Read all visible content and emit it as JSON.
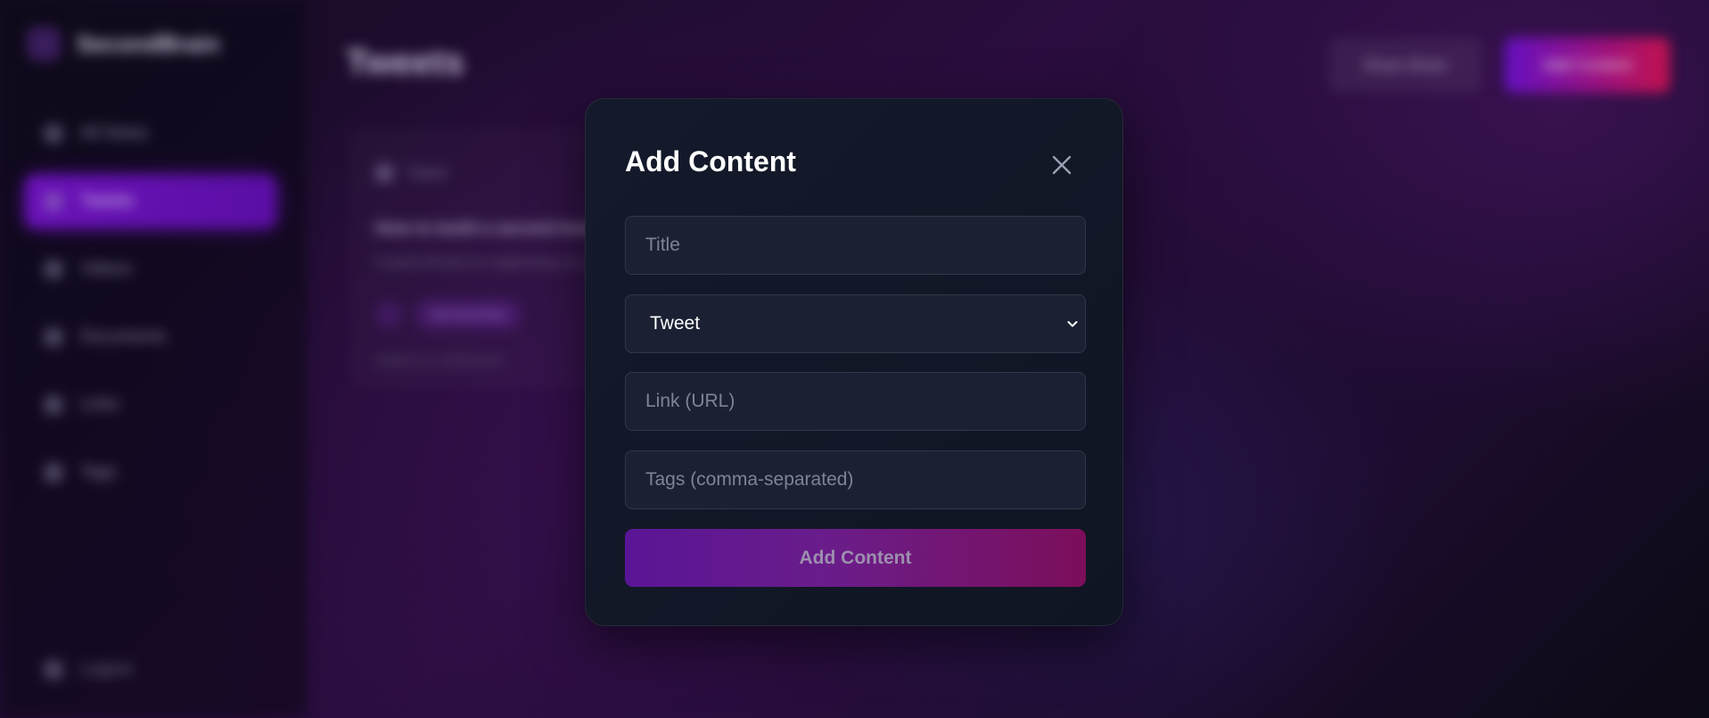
{
  "background": {
    "brand_name": "SecondBrain",
    "nav": [
      {
        "label": "All Notes"
      },
      {
        "label": "Tweets"
      },
      {
        "label": "Videos"
      },
      {
        "label": "Documents"
      },
      {
        "label": "Links"
      },
      {
        "label": "Tags"
      }
    ],
    "logout_label": "Logout",
    "page_title": "Tweets",
    "share_label": "Share Brain",
    "add_label": "Add Content",
    "card": {
      "type_label": "Tweet",
      "title": "How to build a second brain",
      "description": "A quick thread on organizing your ideas",
      "tag": "#productivity",
      "date": "Added on 12/05/2024"
    }
  },
  "modal": {
    "title": "Add Content",
    "title_placeholder": "Title",
    "type_value": "Tweet",
    "link_placeholder": "Link (URL)",
    "tags_placeholder": "Tags (comma-separated)",
    "submit_label": "Add Content"
  },
  "colors": {
    "modal_bg": "#141a2b",
    "input_bg": "#1b2133",
    "accent_start": "#5a1596",
    "accent_end": "#7c0e5a"
  },
  "icons": {
    "close": "close-icon",
    "dropdown": "chevron-down-icon"
  }
}
